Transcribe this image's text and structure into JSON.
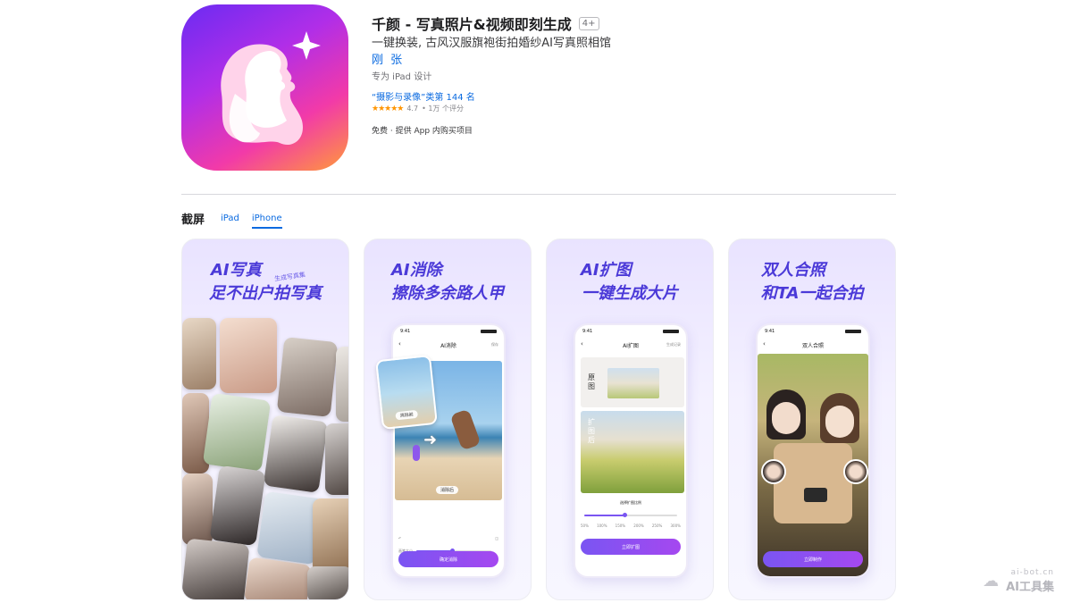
{
  "app": {
    "title": "千颜 - 写真照片&视频即刻生成",
    "age_rating": "4+",
    "subtitle": "一键换装, 古风汉服旗袍街拍婚纱AI写真照相馆",
    "developer": "刚 张",
    "designed_for": "专为 iPad 设计",
    "ranking": "“摄影与录像”类第 144 名",
    "rating_value": "4.7",
    "rating_count": "• 1万 个评分",
    "stars": "★★★★★",
    "price": "免费 · 提供 App 内购买项目"
  },
  "screenshots": {
    "section_title": "截屏",
    "tabs": [
      {
        "label": "iPad",
        "active": false
      },
      {
        "label": "iPhone",
        "active": true
      }
    ],
    "cards": [
      {
        "headline_1": "AI写真",
        "headline_2": "足不出户拍写真",
        "tag": "生成写真集"
      },
      {
        "headline_1": "AI消除",
        "headline_2": "擦除多余路人甲",
        "time": "9:41",
        "nav_title": "AI消除",
        "nav_right": "保存",
        "chip_before": "消除前",
        "chip_after": "消除后",
        "slider_label": "画笔大小",
        "button": "确定消除"
      },
      {
        "headline_1": "AI扩图",
        "headline_2": "一键生成大片",
        "time": "9:41",
        "nav_title": "AI扩图",
        "nav_right": "生成记录",
        "label_original": "原图",
        "label_expanded": "扩图后",
        "prompt": "选择扩图比例",
        "ratios": [
          "50%",
          "100%",
          "150%",
          "200%",
          "250%",
          "300%"
        ],
        "button": "立即扩图"
      },
      {
        "headline_1": "双人合照",
        "headline_2": "和TA一起合拍",
        "time": "9:41",
        "nav_title": "双人合照",
        "button": "立即制作"
      }
    ]
  },
  "watermark": {
    "url": "ai-bot.cn",
    "name": "AI工具集"
  },
  "colors": {
    "link_blue": "#0a6ae0",
    "headline_purple": "#4b3ad8",
    "button_purple": "#7a55f2",
    "star_orange": "#ff9500"
  }
}
